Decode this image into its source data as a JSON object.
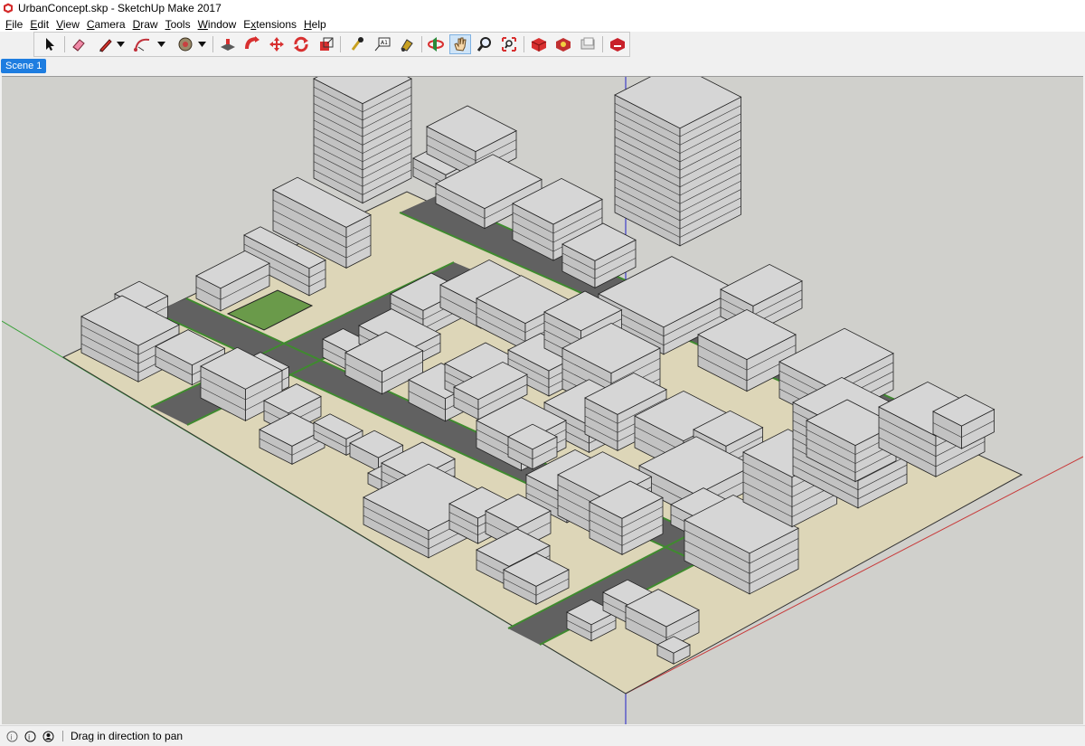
{
  "window": {
    "title": "UrbanConcept.skp - SketchUp Make 2017"
  },
  "menu": [
    {
      "label": "File",
      "key": "F"
    },
    {
      "label": "Edit",
      "key": "E"
    },
    {
      "label": "View",
      "key": "V"
    },
    {
      "label": "Camera",
      "key": "C"
    },
    {
      "label": "Draw",
      "key": "D"
    },
    {
      "label": "Tools",
      "key": "T"
    },
    {
      "label": "Window",
      "key": "W"
    },
    {
      "label": "Extensions",
      "key": "x"
    },
    {
      "label": "Help",
      "key": "H"
    }
  ],
  "toolbar": {
    "tools": [
      "select-icon",
      "eraser-icon",
      "pencil-line-icon",
      "arc-icon",
      "paint-bucket-icon",
      "push-pull-icon",
      "follow-me-icon",
      "move-icon",
      "rotate-icon",
      "scale-icon",
      "tape-measure-icon",
      "text-icon",
      "paint-icon",
      "orbit-icon",
      "pan-icon",
      "zoom-icon",
      "zoom-extents-icon",
      "3d-warehouse-icon",
      "extension-warehouse-icon",
      "layout-icon",
      "extension-manager-icon"
    ],
    "active_tool": "pan-icon"
  },
  "scenes": [
    {
      "label": "Scene 1",
      "active": true
    }
  ],
  "status": {
    "text": "Drag in direction to pan"
  },
  "colors": {
    "sky": "#d0d0cc",
    "ground": "#ddd6b8",
    "road": "#616161",
    "curb": "#3f8a2f",
    "building": "#d6d6d6",
    "park": "#6a9a4a",
    "scene_tab": "#1e7de0",
    "axis_blue": "#2020c8",
    "axis_red": "#c83a3a",
    "axis_green": "#3aa03a"
  }
}
